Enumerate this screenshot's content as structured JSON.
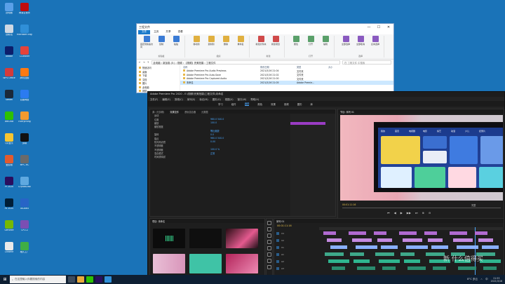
{
  "desktop": {
    "icons": [
      {
        "label": "此电脑",
        "color": "#5aa0e8"
      },
      {
        "label": "回收站",
        "color": "#cfd8e3"
      },
      {
        "label": "Adobe",
        "color": "#0c1e6b"
      },
      {
        "label": "WPS Office",
        "color": "#d43b3b"
      },
      {
        "label": "Steam",
        "color": "#1b2838"
      },
      {
        "label": "WeChat",
        "color": "#2dc100"
      },
      {
        "label": "QQ音乐",
        "color": "#f6c531"
      },
      {
        "label": "爱剪辑",
        "color": "#e25b2f"
      },
      {
        "label": "Pr 2020",
        "color": "#2a0e5e"
      },
      {
        "label": "Ps 2020",
        "color": "#001e36"
      },
      {
        "label": "GeForce",
        "color": "#76b900"
      },
      {
        "label": "Chrome",
        "color": "#e9e9e9"
      },
      {
        "label": "网易云音乐",
        "color": "#c20c0c"
      },
      {
        "label": "Microsoft Edge",
        "color": "#2f8fd8"
      },
      {
        "label": "CCleaner",
        "color": "#e5433b"
      },
      {
        "label": "腾讯视频",
        "color": "#ff7a12"
      },
      {
        "label": "百度网盘",
        "color": "#2b7bf0"
      },
      {
        "label": "Everything",
        "color": "#f29a2e"
      },
      {
        "label": "剪映",
        "color": "#111111"
      },
      {
        "label": "MPC-HC",
        "color": "#6a6a6a"
      },
      {
        "label": "CrystalDisk",
        "color": "#5fa9e0"
      },
      {
        "label": "AIDA64",
        "color": "#2764c6"
      },
      {
        "label": "CPU-Z",
        "color": "#7b4fb3"
      },
      {
        "label": "格式工厂",
        "color": "#3fae45"
      }
    ]
  },
  "explorer": {
    "title": "工程文件",
    "controls": [
      "—",
      "☐",
      "✕"
    ],
    "tabs": [
      "文件",
      "主页",
      "共享",
      "查看"
    ],
    "ribbon_groups": [
      {
        "name": "剪贴板",
        "buttons": [
          "固定到快速访问",
          "复制",
          "粘贴"
        ]
      },
      {
        "name": "组织",
        "buttons": [
          "移动到",
          "复制到",
          "删除",
          "重命名"
        ]
      },
      {
        "name": "新建",
        "buttons": [
          "新建文件夹",
          "新建项目"
        ]
      },
      {
        "name": "打开",
        "buttons": [
          "属性",
          "打开",
          "编辑"
        ]
      },
      {
        "name": "选择",
        "buttons": [
          "全部选择",
          "全部取消",
          "反向选择"
        ]
      }
    ],
    "address": "此电脑 › 新加卷 (E:) › 视频 › 【视频】完美拍摄 › 工程文件",
    "search_placeholder": "在 工程文件 中搜索",
    "nav_items": [
      "快速访问",
      "桌面",
      "下载",
      "文档",
      "图片",
      "此电脑",
      "网络"
    ],
    "columns": [
      "名称",
      "修改日期",
      "类型",
      "大小"
    ],
    "files": [
      {
        "name": "Adobe Premiere Pro Audio Previews",
        "date": "2021/3/16 21:04",
        "type": "文件夹",
        "size": ""
      },
      {
        "name": "Adobe Premiere Pro Auto-Save",
        "date": "2021/3/16 21:02",
        "type": "文件夹",
        "size": ""
      },
      {
        "name": "Adobe Premiere Pro Captured Audio",
        "date": "2021/3/16 21:00",
        "type": "文件夹",
        "size": ""
      },
      {
        "name": "未命名",
        "date": "2021/3/16 21:05",
        "type": "Adobe Premie...",
        "size": "",
        "selected": true
      }
    ]
  },
  "premiere": {
    "title": "Adobe Premiere Pro 2020 - E:\\视频\\完美拍摄\\工程文件\\未命名",
    "menu": [
      "文件(F)",
      "编辑(E)",
      "剪辑(C)",
      "序列(S)",
      "标记(M)",
      "图形(G)",
      "视图(V)",
      "窗口(W)",
      "帮助(H)"
    ],
    "workspaces": [
      "学习",
      "组件",
      "编辑",
      "颜色",
      "效果",
      "音频",
      "图形",
      "库"
    ],
    "active_workspace": "编辑",
    "effect_tabs": [
      "源: (无剪辑)",
      "效果控件",
      "音轨混合器",
      "元数据"
    ],
    "effect_rows": [
      {
        "k": "运动",
        "v": ""
      },
      {
        "k": "位置",
        "v": "960.0 540.0"
      },
      {
        "k": "缩放",
        "v": "100.0"
      },
      {
        "k": "缩放宽度",
        "v": ""
      },
      {
        "k": "",
        "v": "等比缩放"
      },
      {
        "k": "旋转",
        "v": "0.0"
      },
      {
        "k": "锚点",
        "v": "960.0 540.0"
      },
      {
        "k": "防闪烁滤镜",
        "v": "0.00"
      },
      {
        "k": "不透明度",
        "v": ""
      },
      {
        "k": "不透明度",
        "v": "100.0 %"
      },
      {
        "k": "混合模式",
        "v": "正常"
      },
      {
        "k": "时间重映射",
        "v": ""
      }
    ],
    "program_tab": "节目: 序列 01",
    "program_timecode": "00:01:11:16",
    "program_fit": "完整",
    "tv_tabs": [
      "我的",
      "首页",
      "电视剧",
      "电影",
      "综艺",
      "动漫",
      "少儿",
      "纪录片"
    ],
    "playback_buttons": [
      "⏮",
      "◀",
      "▶",
      "▶▶",
      "⏭",
      "⊕",
      "⊖"
    ],
    "project_tab": "项目: 未命名",
    "timeline_tab": "序列 01",
    "timeline_timecode": "00:01:11:16",
    "tracks": [
      "V3",
      "V2",
      "V1",
      "A1",
      "A2",
      "A3"
    ]
  },
  "taskbar": {
    "search_placeholder": "在这里输入你要搜索的内容",
    "tray_icons": [
      "^",
      "中",
      "英"
    ],
    "time": "21:53",
    "date": "2021/3/16",
    "weather": "8°C 多云"
  },
  "watermark": "新 什么值得买"
}
